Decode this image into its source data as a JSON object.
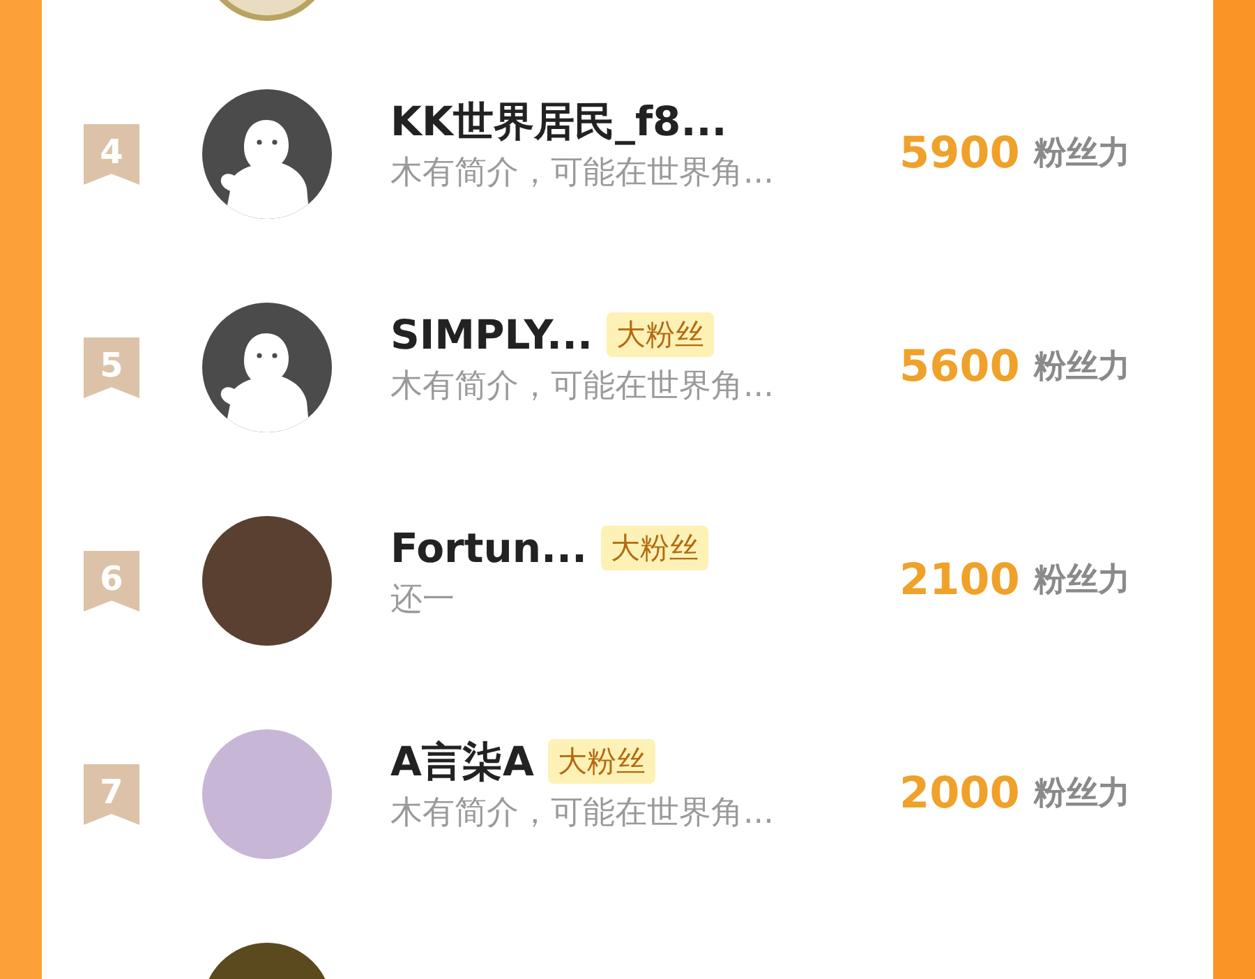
{
  "rows": [
    {
      "rank": "4",
      "kind": "default",
      "name": "KK世界居民_f8...",
      "badge": null,
      "description": "木有简介，可能在世界角...",
      "score": "5900",
      "unit": "粉丝力"
    },
    {
      "rank": "5",
      "kind": "default",
      "name": "SIMPLY...",
      "badge": "大粉丝",
      "description": "木有简介，可能在世界角...",
      "score": "5600",
      "unit": "粉丝力"
    },
    {
      "rank": "6",
      "kind": "photo",
      "name": "Fortun...",
      "badge": "大粉丝",
      "description": "还一",
      "score": "2100",
      "unit": "粉丝力"
    },
    {
      "rank": "7",
      "kind": "photo",
      "name": "A言柒A",
      "badge": "大粉丝",
      "description": "木有简介，可能在世界角...",
      "score": "2000",
      "unit": "粉丝力"
    },
    {
      "kind": "photo"
    }
  ]
}
